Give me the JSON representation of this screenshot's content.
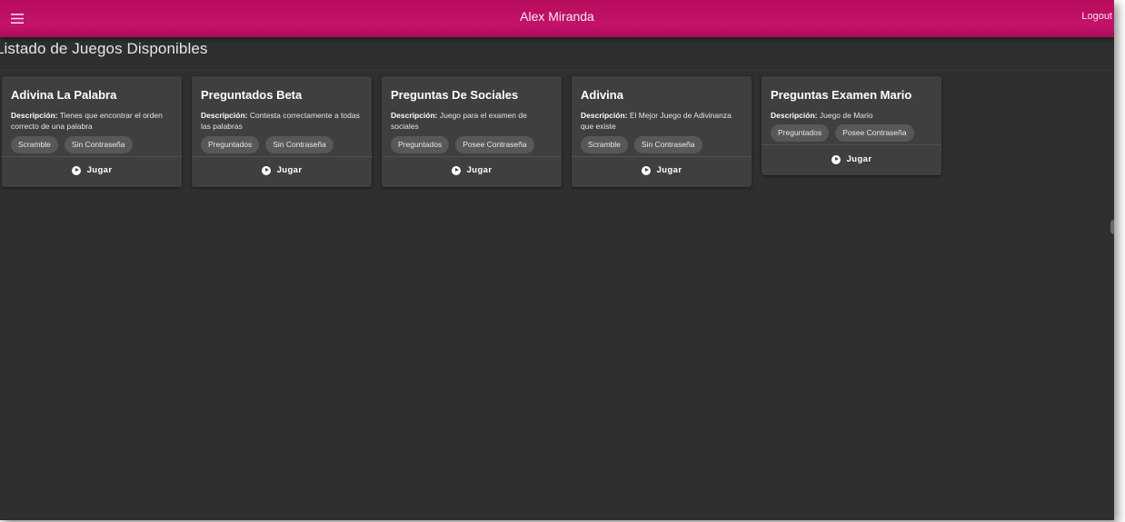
{
  "appbar": {
    "title": "Alex Miranda",
    "logout_label": "Logout",
    "menu_icon": "hamburger-menu-icon",
    "color": "#c4136b"
  },
  "page": {
    "title": "Listado de Juegos Disponibles",
    "background": "#2f2f2f"
  },
  "description_label": "Descripción:",
  "play_label": "Jugar",
  "play_icon": "play-circle-icon",
  "games": [
    {
      "title": "Adivina La Palabra",
      "description": "Tienes que encontrar el orden correcto de una palabra",
      "chips": [
        "Scramble",
        "Sin Contraseña"
      ]
    },
    {
      "title": "Preguntados Beta",
      "description": "Contesta correctamente a todas las palabras",
      "chips": [
        "Preguntados",
        "Sin Contraseña"
      ]
    },
    {
      "title": "Preguntas De Sociales",
      "description": "Juego para el examen de sociales",
      "chips": [
        "Preguntados",
        "Posee Contraseña"
      ]
    },
    {
      "title": "Adivina",
      "description": "El Mejor Juego de Adivinanza que existe",
      "chips": [
        "Scramble",
        "Sin Contraseña"
      ]
    },
    {
      "title": "Preguntas Examen Mario",
      "description": "Juego de Mario",
      "chips": [
        "Preguntados",
        "Posee Contraseña"
      ]
    }
  ]
}
